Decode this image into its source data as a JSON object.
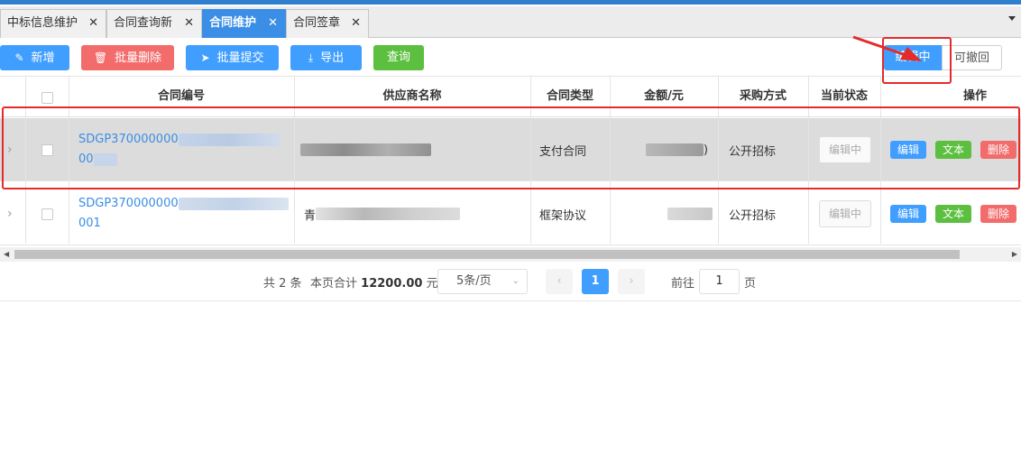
{
  "tabs": [
    {
      "label": "中标信息维护",
      "active": false
    },
    {
      "label": "合同查询新",
      "active": false
    },
    {
      "label": "合同维护",
      "active": true
    },
    {
      "label": "合同签章",
      "active": false
    }
  ],
  "tab_close_glyph": "✕",
  "toolbar": {
    "add_label": "新增",
    "batch_delete_label": "批量删除",
    "batch_submit_label": "批量提交",
    "export_label": "导出",
    "query_label": "查询"
  },
  "status_filter": {
    "active_label": "编辑中",
    "other_label": "可撤回"
  },
  "table": {
    "columns": [
      "合同编号",
      "供应商名称",
      "合同类型",
      "金额/元",
      "采购方式",
      "当前状态",
      "操作"
    ],
    "rows": [
      {
        "contract_no_line1": "SDGP370000000",
        "contract_no_line2": "00",
        "supplier": "",
        "contract_type": "支付合同",
        "amount_tail": ")",
        "procurement_method": "公开招标",
        "status": "编辑中",
        "actions": [
          "编辑",
          "文本",
          "删除"
        ]
      },
      {
        "contract_no_line1": "SDGP370000000",
        "contract_no_line2": "001",
        "supplier": "青",
        "contract_type": "框架协议",
        "amount_tail": "",
        "procurement_method": "公开招标",
        "status": "编辑中",
        "actions": [
          "编辑",
          "文本",
          "删除"
        ]
      }
    ]
  },
  "pagination": {
    "total_text": "共 2 条",
    "page_sum_label": "本页合计",
    "page_sum_value": "12200.00",
    "page_sum_unit": "元",
    "page_size": "5条/页",
    "current_page": "1",
    "goto_label": "前往",
    "goto_value": "1",
    "goto_unit": "页"
  },
  "colors": {
    "primary": "#409eff",
    "danger": "#f26c6c",
    "success": "#5cbf3f",
    "annotation": "#e52a2a"
  }
}
